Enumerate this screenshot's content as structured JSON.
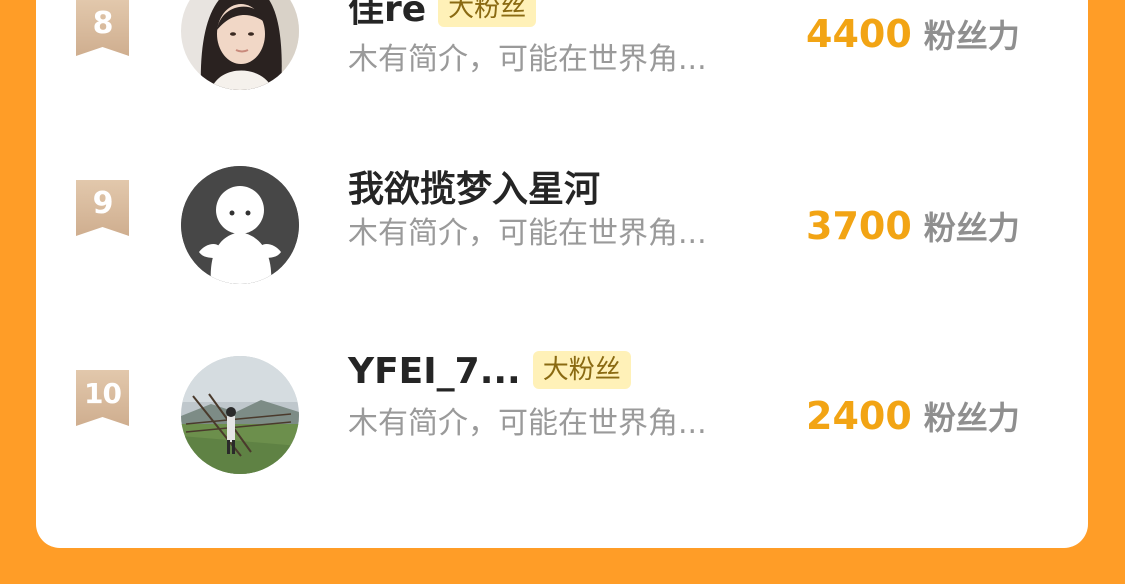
{
  "ranking": {
    "items": [
      {
        "rank": "8",
        "name": "佳re",
        "badge": "大粉丝",
        "bio": "木有简介，可能在世界角...",
        "score": "4400",
        "unit": "粉丝力"
      },
      {
        "rank": "9",
        "name": "我欲揽梦入星河",
        "badge": "",
        "bio": "木有简介，可能在世界角...",
        "score": "3700",
        "unit": "粉丝力"
      },
      {
        "rank": "10",
        "name": "YFEI_7...",
        "badge": "大粉丝",
        "bio": "木有简介，可能在世界角...",
        "score": "2400",
        "unit": "粉丝力"
      }
    ]
  },
  "colors": {
    "background": "#FF9D27",
    "card": "#FFFFFF",
    "score": "#F2A414",
    "badge_bg": "#FFF1B8",
    "rank_badge": "#D8B99B"
  },
  "icons": {
    "avatar_8": "portrait-photo-avatar",
    "avatar_9": "default-ghost-avatar",
    "avatar_10": "landscape-photo-avatar"
  }
}
